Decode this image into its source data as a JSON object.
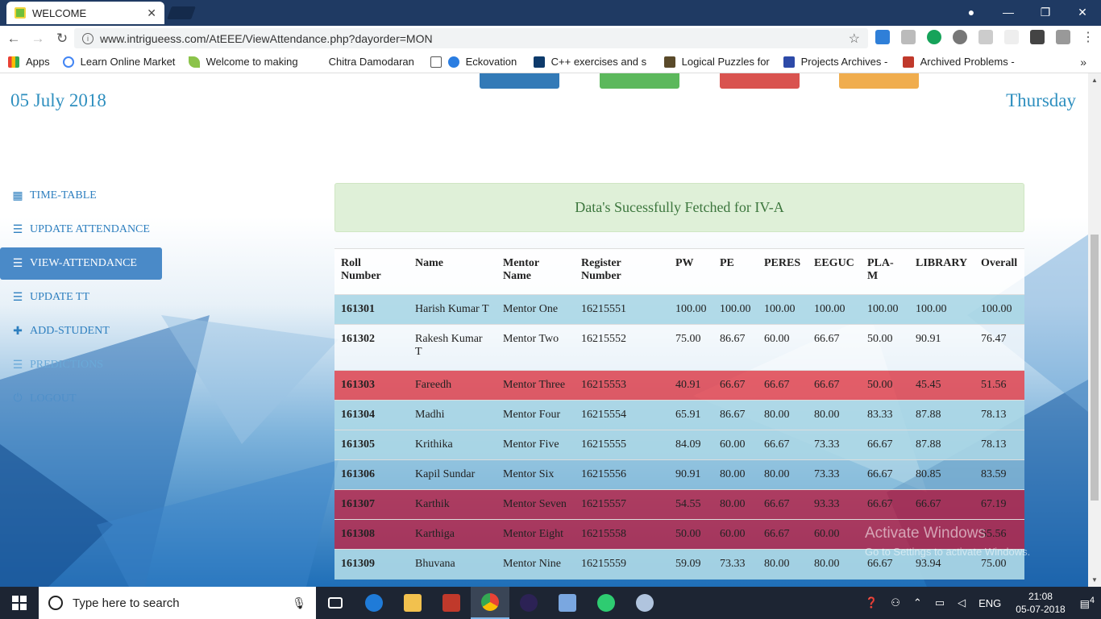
{
  "browser": {
    "tab_title": "WELCOME",
    "url": "www.intrigueess.com/AtEEE/ViewAttendance.php?dayorder=MON",
    "bookmarks": [
      "Apps",
      "Learn Online Market",
      "Welcome to making",
      "Chitra Damodaran",
      "Eckovation",
      "C++ exercises and s",
      "Logical Puzzles for Ir",
      "Projects Archives - T",
      "Archived Problems -"
    ]
  },
  "header": {
    "date": "05 July 2018",
    "day": "Thursday"
  },
  "sidebar": {
    "items": [
      {
        "label": "TIME-TABLE",
        "icon": "calendar-icon"
      },
      {
        "label": "UPDATE ATTENDANCE",
        "icon": "list-icon"
      },
      {
        "label": "VIEW-ATTENDANCE",
        "icon": "list-icon"
      },
      {
        "label": "UPDATE TT",
        "icon": "list-icon"
      },
      {
        "label": "ADD-STUDENT",
        "icon": "plus-icon"
      },
      {
        "label": "PREDICTIONS",
        "icon": "list-icon"
      },
      {
        "label": "LOGOUT",
        "icon": "power-icon"
      }
    ]
  },
  "alert": {
    "message": "Data's Sucessfully Fetched for IV-A"
  },
  "table": {
    "headers": {
      "roll_a": "Roll",
      "roll_b": "Number",
      "name": "Name",
      "mentor_a": "Mentor",
      "mentor_b": "Name",
      "reg_a": "Register",
      "reg_b": "Number",
      "pw": "PW",
      "pe": "PE",
      "peres": "PERES",
      "eeguc": "EEGUC",
      "pla_a": "PLA-",
      "pla_b": "M",
      "library": "LIBRARY",
      "overall": "Overall"
    },
    "rows": [
      {
        "roll": "161301",
        "name": "Harish Kumar T",
        "mentor": "Mentor One",
        "reg": "16215551",
        "pw": "100.00",
        "pe": "100.00",
        "peres": "100.00",
        "eeguc": "100.00",
        "plam": "100.00",
        "library": "100.00",
        "overall": "100.00"
      },
      {
        "roll": "161302",
        "name": "Rakesh Kumar T",
        "mentor": "Mentor Two",
        "reg": "16215552",
        "pw": "75.00",
        "pe": "86.67",
        "peres": "60.00",
        "eeguc": "66.67",
        "plam": "50.00",
        "library": "90.91",
        "overall": "76.47"
      },
      {
        "roll": "161303",
        "name": "Fareedh",
        "mentor": "Mentor Three",
        "reg": "16215553",
        "pw": "40.91",
        "pe": "66.67",
        "peres": "66.67",
        "eeguc": "66.67",
        "plam": "50.00",
        "library": "45.45",
        "overall": "51.56"
      },
      {
        "roll": "161304",
        "name": "Madhi",
        "mentor": "Mentor Four",
        "reg": "16215554",
        "pw": "65.91",
        "pe": "86.67",
        "peres": "80.00",
        "eeguc": "80.00",
        "plam": "83.33",
        "library": "87.88",
        "overall": "78.13"
      },
      {
        "roll": "161305",
        "name": "Krithika",
        "mentor": "Mentor Five",
        "reg": "16215555",
        "pw": "84.09",
        "pe": "60.00",
        "peres": "66.67",
        "eeguc": "73.33",
        "plam": "66.67",
        "library": "87.88",
        "overall": "78.13"
      },
      {
        "roll": "161306",
        "name": "Kapil Sundar",
        "mentor": "Mentor Six",
        "reg": "16215556",
        "pw": "90.91",
        "pe": "80.00",
        "peres": "80.00",
        "eeguc": "73.33",
        "plam": "66.67",
        "library": "80.85",
        "overall": "83.59"
      },
      {
        "roll": "161307",
        "name": "Karthik",
        "mentor": "Mentor Seven",
        "reg": "16215557",
        "pw": "54.55",
        "pe": "80.00",
        "peres": "66.67",
        "eeguc": "93.33",
        "plam": "66.67",
        "library": "66.67",
        "overall": "67.19"
      },
      {
        "roll": "161308",
        "name": "Karthiga",
        "mentor": "Mentor Eight",
        "reg": "16215558",
        "pw": "50.00",
        "pe": "60.00",
        "peres": "66.67",
        "eeguc": "60.00",
        "plam": "",
        "library": "",
        "overall": "55.56"
      },
      {
        "roll": "161309",
        "name": "Bhuvana",
        "mentor": "Mentor Nine",
        "reg": "16215559",
        "pw": "59.09",
        "pe": "73.33",
        "peres": "80.00",
        "eeguc": "80.00",
        "plam": "66.67",
        "library": "93.94",
        "overall": "75.00"
      }
    ]
  },
  "watermark": {
    "line1": "Activate Windows",
    "line2": "Go to Settings to activate Windows."
  },
  "taskbar": {
    "search_placeholder": "Type here to search",
    "lang": "ENG",
    "time": "21:08",
    "date": "05-07-2018",
    "notifications": "4"
  },
  "colors": {
    "accent": "#2e8fbf",
    "alert_bg": "#dff0d8",
    "low_row": "#e64650",
    "ok_row": "#add8e6"
  }
}
